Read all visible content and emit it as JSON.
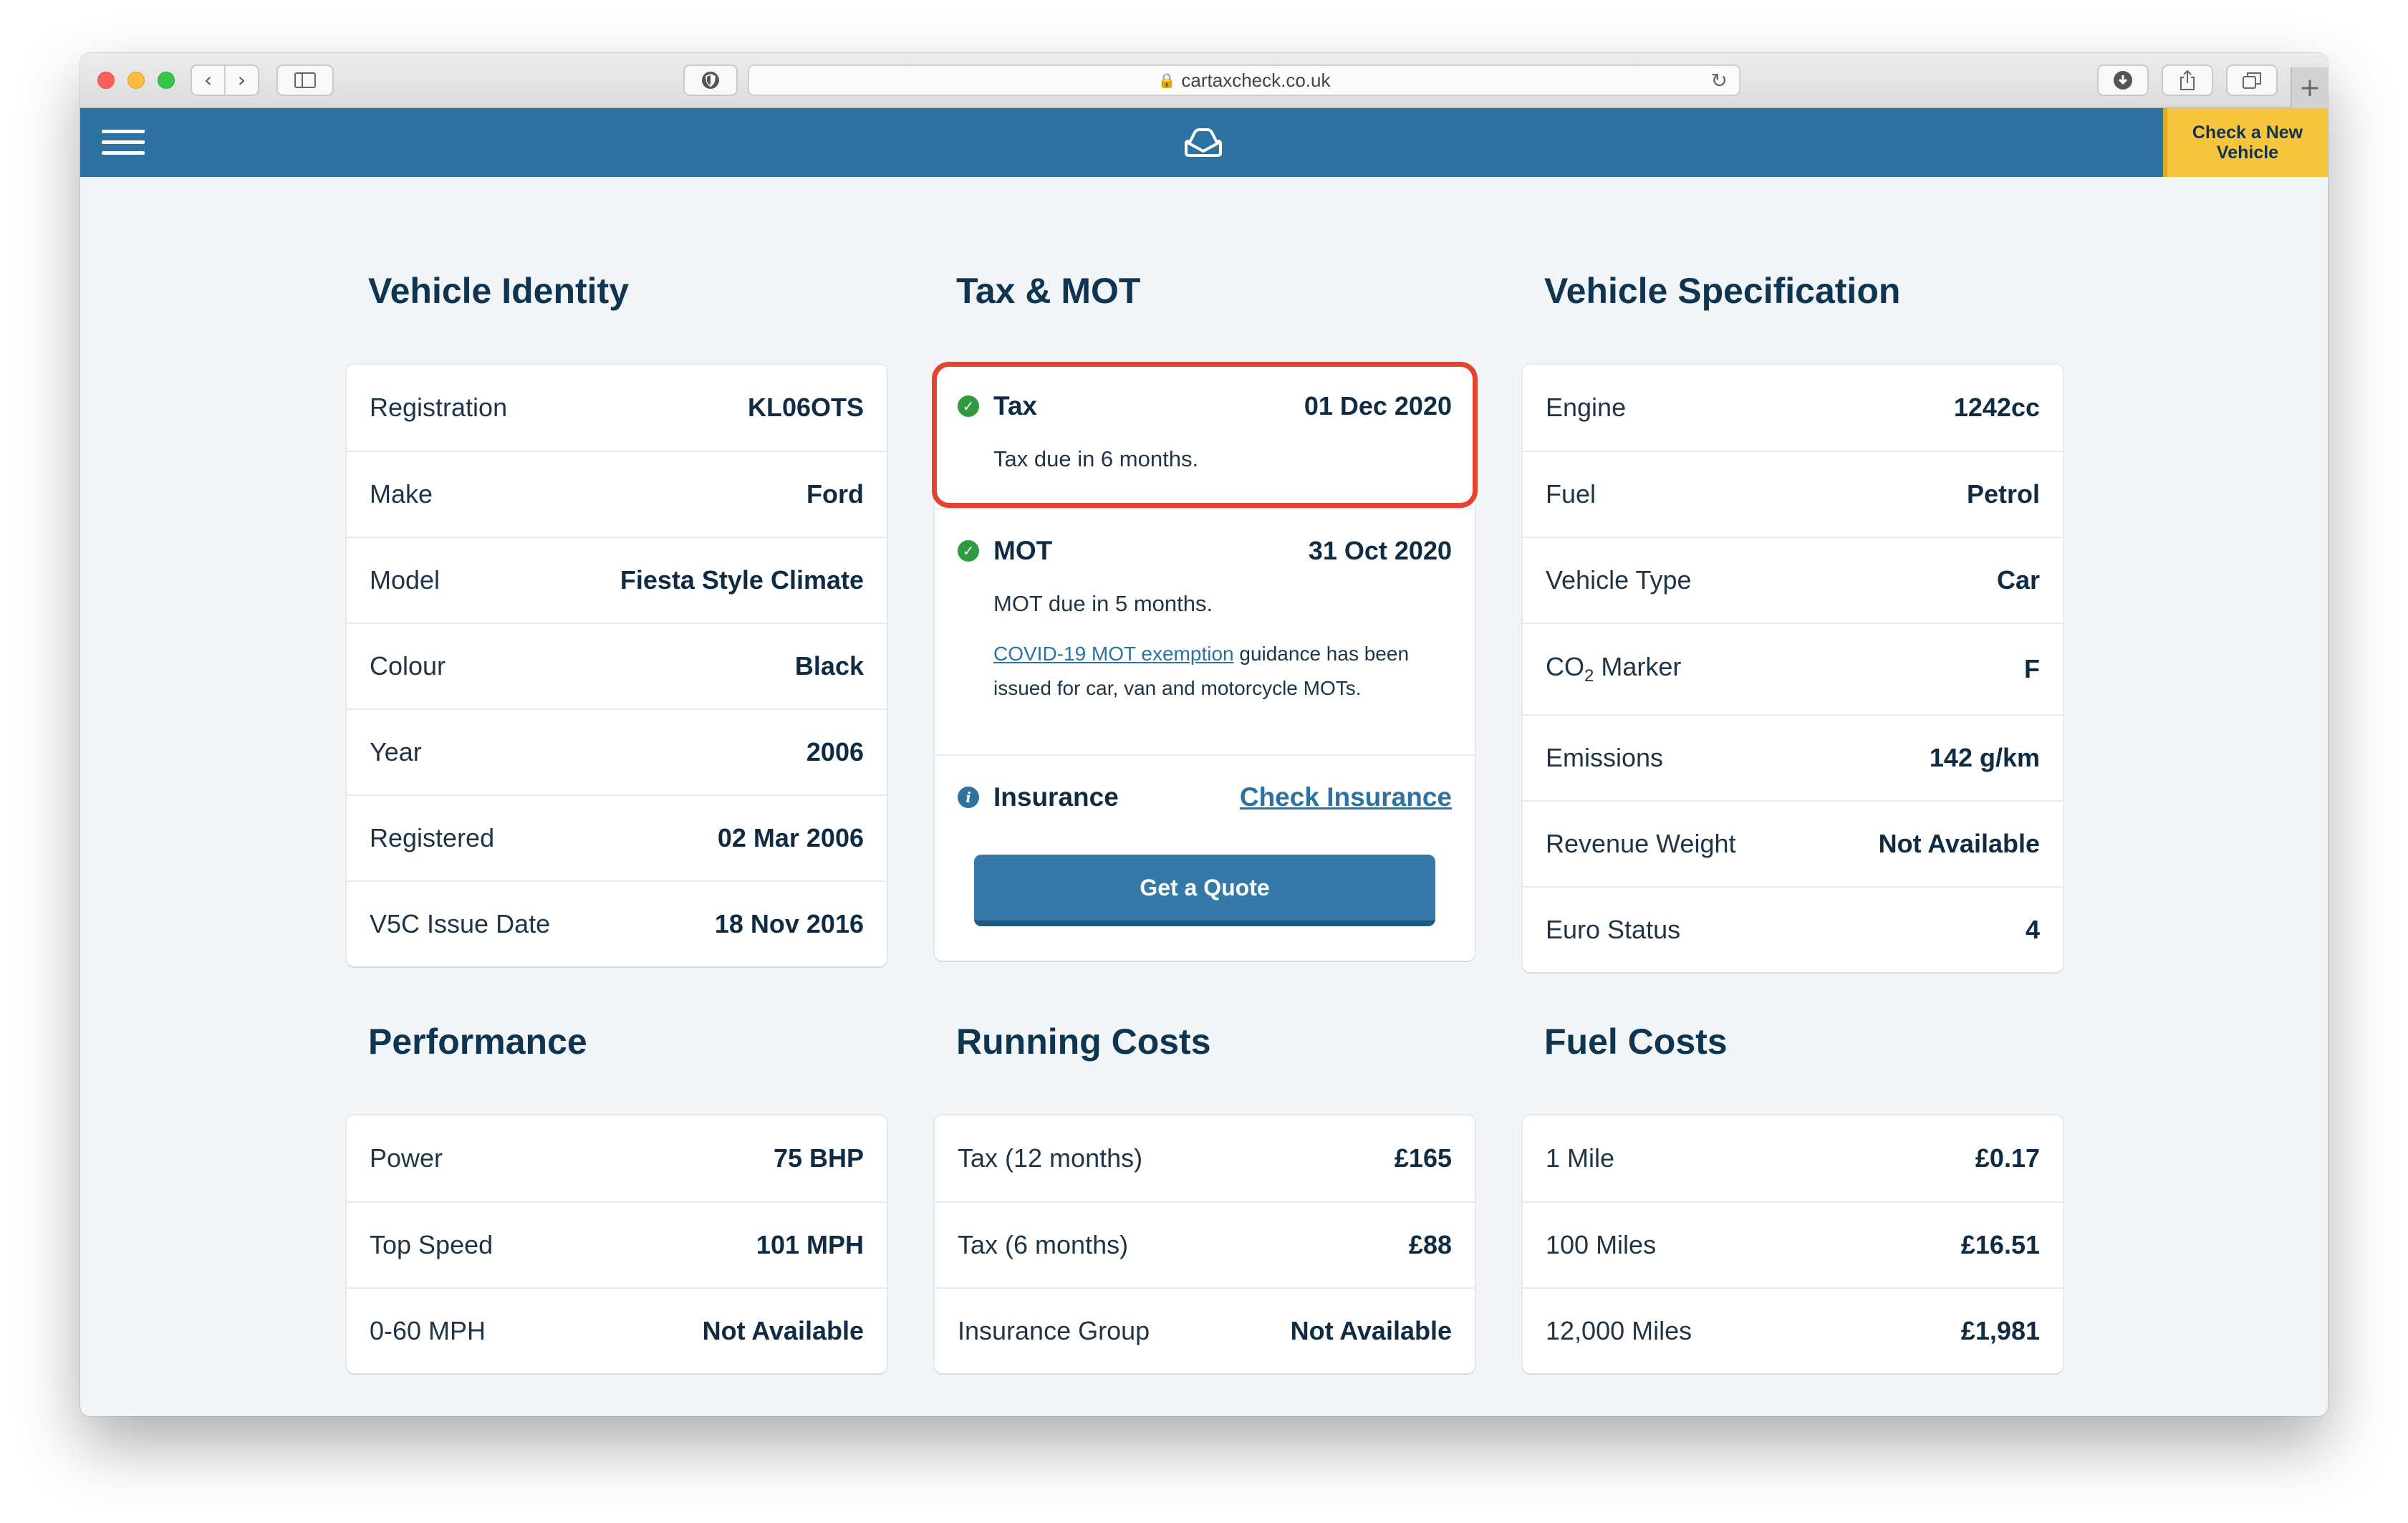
{
  "browser": {
    "url": "cartaxcheck.co.uk",
    "nav_back": "‹",
    "nav_forward": "›",
    "reload_icon": "↻",
    "new_tab": "+"
  },
  "header": {
    "check_button": "Check a New Vehicle",
    "brand_color": "#2d72a1",
    "accent_color": "#f7c53c"
  },
  "vehicle_identity": {
    "title": "Vehicle Identity",
    "rows": [
      {
        "label": "Registration",
        "value": "KL06OTS"
      },
      {
        "label": "Make",
        "value": "Ford"
      },
      {
        "label": "Model",
        "value": "Fiesta Style Climate"
      },
      {
        "label": "Colour",
        "value": "Black"
      },
      {
        "label": "Year",
        "value": "2006"
      },
      {
        "label": "Registered",
        "value": "02 Mar 2006"
      },
      {
        "label": "V5C Issue Date",
        "value": "18 Nov 2016"
      }
    ]
  },
  "tax_mot": {
    "title": "Tax & MOT",
    "tax": {
      "label": "Tax",
      "date": "01 Dec 2020",
      "note": "Tax due in 6 months."
    },
    "mot": {
      "label": "MOT",
      "date": "31 Oct 2020",
      "note": "MOT due in 5 months.",
      "covid_link": "COVID-19 MOT exemption",
      "covid_text": " guidance has been issued for car, van and motorcycle MOTs."
    },
    "insurance": {
      "label": "Insurance",
      "link": "Check Insurance",
      "button": "Get a Quote"
    },
    "highlight_color": "#e4432d"
  },
  "vehicle_spec": {
    "title": "Vehicle Specification",
    "rows": [
      {
        "label": "Engine",
        "value": "1242cc"
      },
      {
        "label": "Fuel",
        "value": "Petrol"
      },
      {
        "label": "Vehicle Type",
        "value": "Car"
      },
      {
        "label_pre": "CO",
        "label_sub": "2",
        "label_post": " Marker",
        "value": "F"
      },
      {
        "label": "Emissions",
        "value": "142 g/km"
      },
      {
        "label": "Revenue Weight",
        "value": "Not Available"
      },
      {
        "label": "Euro Status",
        "value": "4"
      }
    ]
  },
  "performance": {
    "title": "Performance",
    "rows": [
      {
        "label": "Power",
        "value": "75 BHP"
      },
      {
        "label": "Top Speed",
        "value": "101 MPH"
      },
      {
        "label": "0-60 MPH",
        "value": "Not Available"
      }
    ]
  },
  "running_costs": {
    "title": "Running Costs",
    "rows": [
      {
        "label": "Tax (12 months)",
        "value": "£165"
      },
      {
        "label": "Tax (6 months)",
        "value": "£88"
      },
      {
        "label": "Insurance Group",
        "value": "Not Available"
      }
    ]
  },
  "fuel_costs": {
    "title": "Fuel Costs",
    "rows": [
      {
        "label": "1 Mile",
        "value": "£0.17"
      },
      {
        "label": "100 Miles",
        "value": "£16.51"
      },
      {
        "label": "12,000 Miles",
        "value": "£1,981"
      }
    ]
  }
}
